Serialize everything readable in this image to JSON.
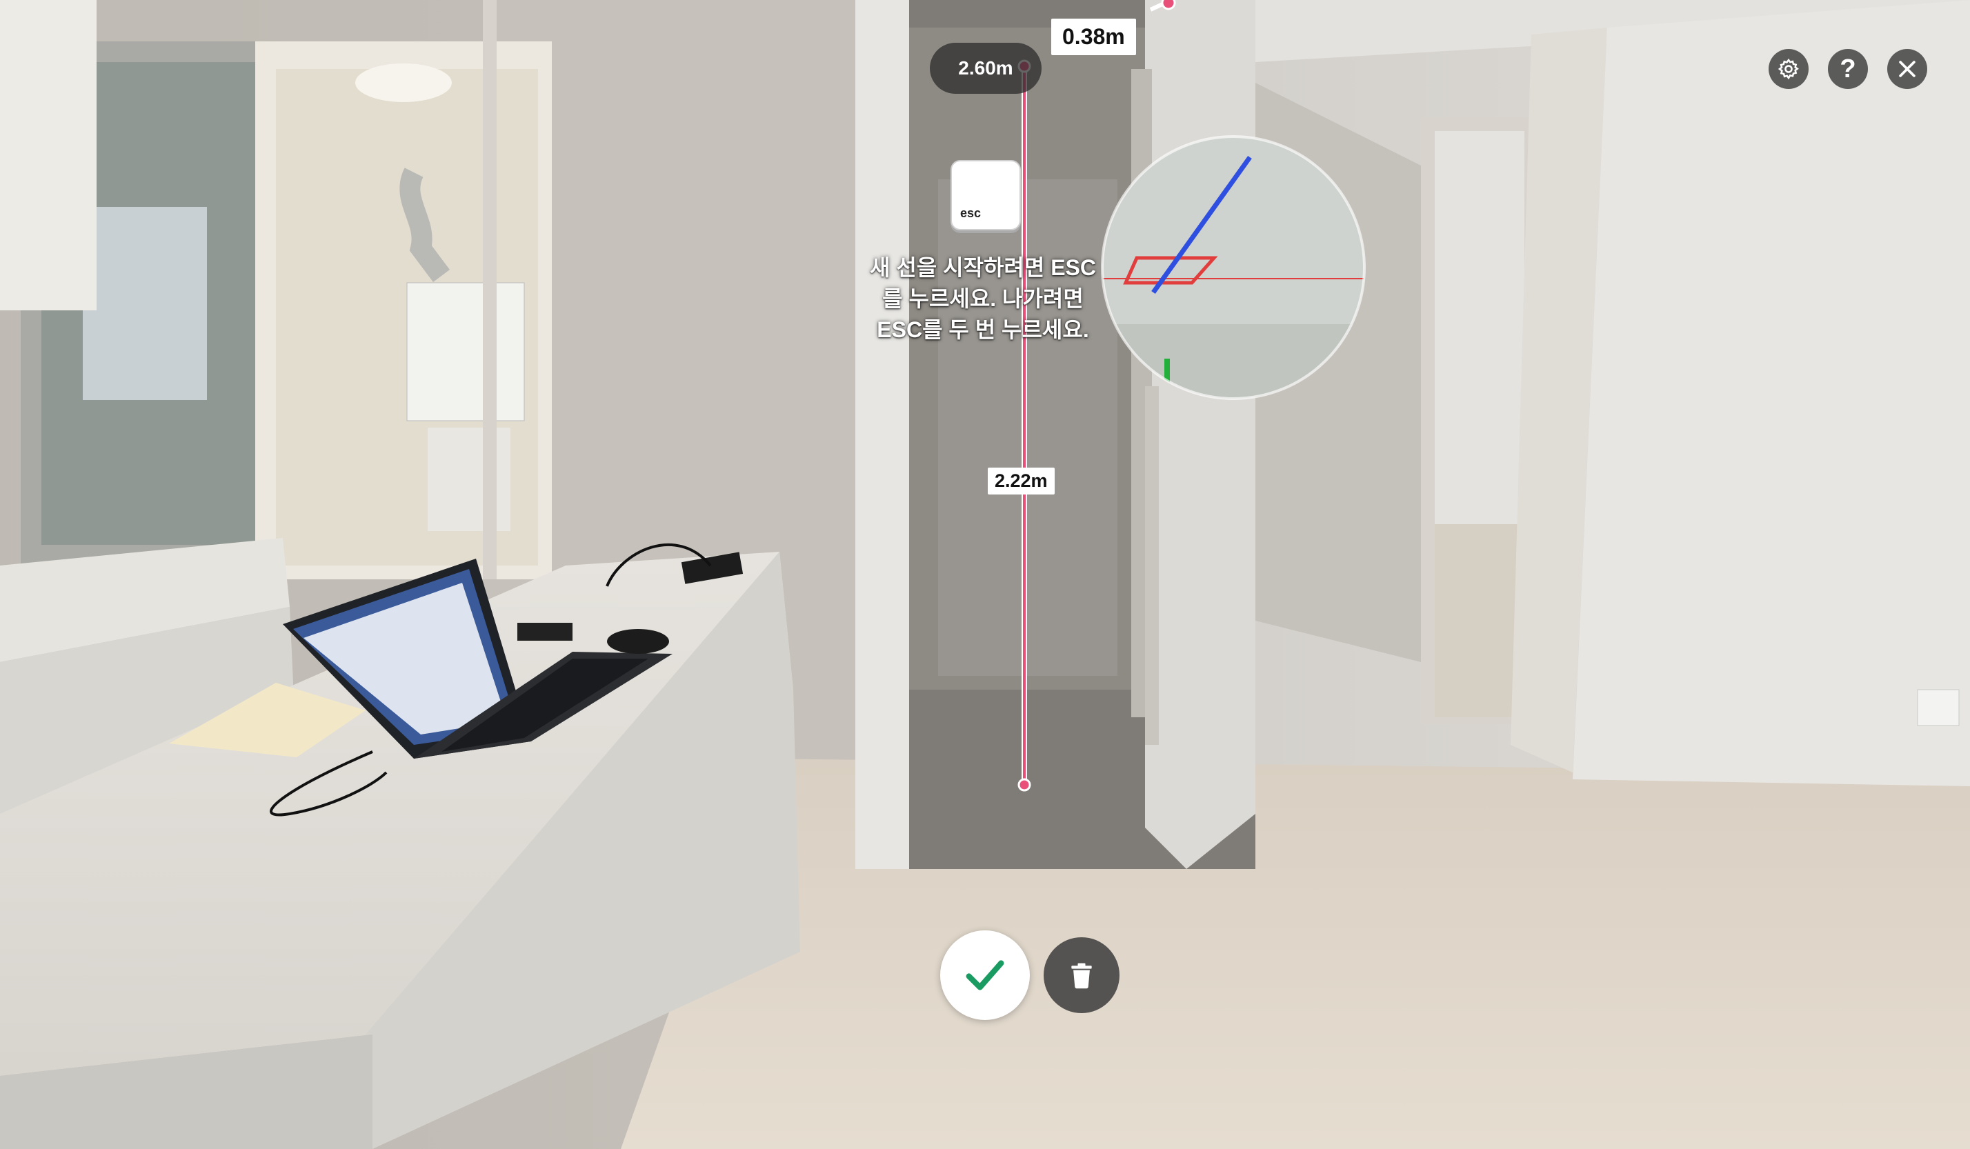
{
  "measurements": {
    "top_distance": "0.38m",
    "height_total": "2.60m",
    "segment_distance": "2.22m"
  },
  "hint": {
    "key_label": "esc",
    "text_line1": "새 선을 시작하려면 ESC",
    "text_line2": "를 누르세요. 나가려면",
    "text_line3": "ESC를 두 번 누르세요."
  },
  "controls": {
    "settings_icon": "gear-icon",
    "help_label": "?",
    "close_icon": "close-icon"
  },
  "actions": {
    "confirm_icon": "checkmark-icon",
    "delete_icon": "trash-icon"
  },
  "colors": {
    "measure_line": "#e8507a",
    "confirm_check": "#1a9b62"
  }
}
